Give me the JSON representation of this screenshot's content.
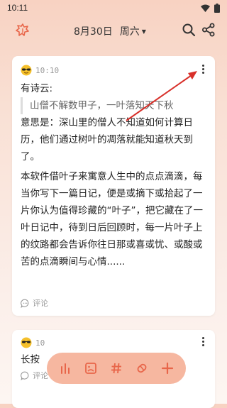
{
  "status": {
    "time": "10:11"
  },
  "header": {
    "date": "8月30日",
    "weekday": "周六"
  },
  "cards": [
    {
      "time": "10:10",
      "intro": "有诗云:",
      "quote": "山僧不解数甲子，一叶落知天下秋",
      "paragraph1": "意思是：深山里的僧人不知道如何计算日历，他们通过树叶的凋落就能知道秋天到了。",
      "paragraph2": "本软件借叶子来寓意人生中的点点滴滴，每当你写下一篇日记，便是或摘下或拾起了一片你认为值得珍藏的“叶子”，把它藏在了一叶日记中，待到日后回顾时，每一片叶子上的纹路都会告诉你往日那或喜或忧、或酸或苦的点滴瞬间与心情......",
      "comment_label": "评论"
    },
    {
      "time": "10",
      "line": "长按",
      "comment_label": "评论"
    }
  ],
  "icons": {
    "logo": "leaf-logo-icon",
    "search": "search-icon",
    "share": "share-icon",
    "more": "more-vertical-icon",
    "sunglasses": "sunglasses-emoji-icon",
    "comment": "comment-icon",
    "stats": "stats-icon",
    "image": "image-icon",
    "tag": "hashtag-icon",
    "eraser": "eraser-icon",
    "add": "add-icon"
  },
  "colors": {
    "accent": "#e8664a",
    "fab_bg": "#f6b7a0",
    "arrow": "#d8302a"
  }
}
